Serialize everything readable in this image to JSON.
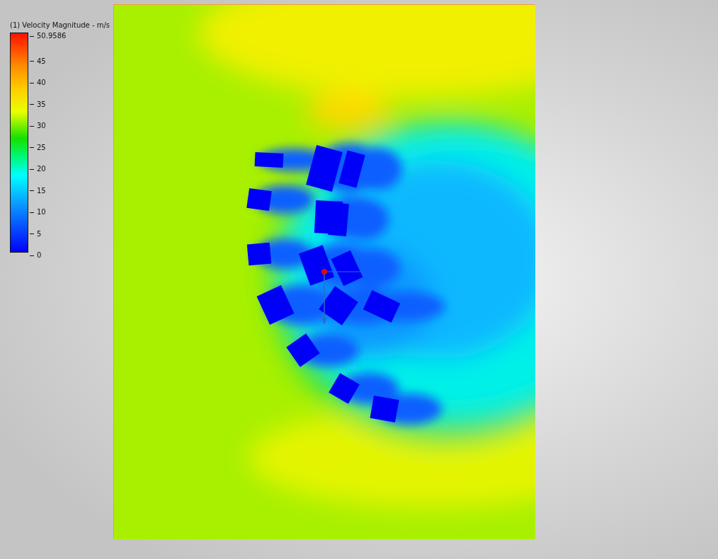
{
  "legend": {
    "title": "(1) Velocity Magnitude - m/s",
    "max_label": "50.9586",
    "ticks": [
      "45",
      "40",
      "35",
      "30",
      "25",
      "20",
      "15",
      "10",
      "5",
      "0"
    ]
  }
}
